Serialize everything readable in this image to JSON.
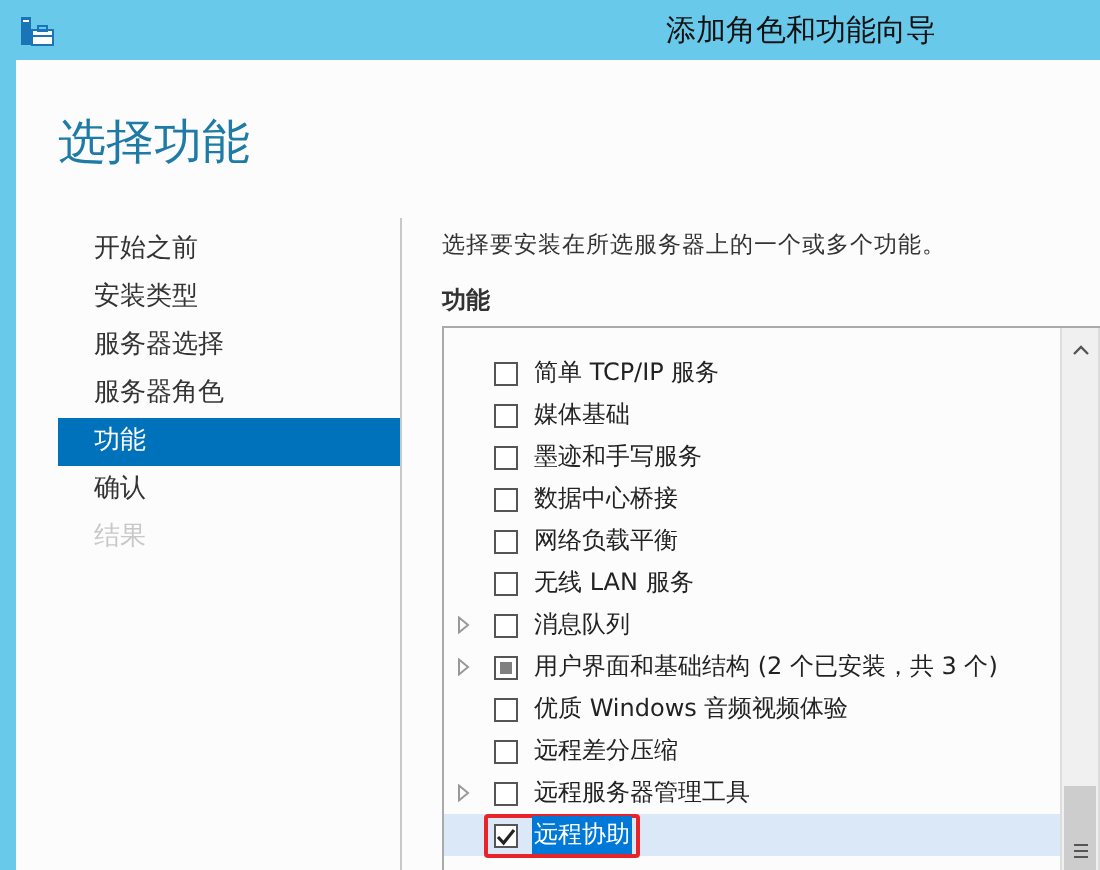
{
  "window": {
    "title": "添加角色和功能向导"
  },
  "page_title": "选择功能",
  "nav": [
    {
      "label": "开始之前",
      "selected": false,
      "disabled": false
    },
    {
      "label": "安装类型",
      "selected": false,
      "disabled": false
    },
    {
      "label": "服务器选择",
      "selected": false,
      "disabled": false
    },
    {
      "label": "服务器角色",
      "selected": false,
      "disabled": false
    },
    {
      "label": "功能",
      "selected": true,
      "disabled": false
    },
    {
      "label": "确认",
      "selected": false,
      "disabled": false
    },
    {
      "label": "结果",
      "selected": false,
      "disabled": true
    }
  ],
  "description": "选择要安装在所选服务器上的一个或多个功能。",
  "features_label": "功能",
  "features": [
    {
      "label": "简单 TCP/IP 服务",
      "checked": false,
      "indeterminate": false,
      "expandable": false,
      "selected": false,
      "marked": false
    },
    {
      "label": "媒体基础",
      "checked": false,
      "indeterminate": false,
      "expandable": false,
      "selected": false,
      "marked": false
    },
    {
      "label": "墨迹和手写服务",
      "checked": false,
      "indeterminate": false,
      "expandable": false,
      "selected": false,
      "marked": false
    },
    {
      "label": "数据中心桥接",
      "checked": false,
      "indeterminate": false,
      "expandable": false,
      "selected": false,
      "marked": false
    },
    {
      "label": "网络负载平衡",
      "checked": false,
      "indeterminate": false,
      "expandable": false,
      "selected": false,
      "marked": false
    },
    {
      "label": "无线 LAN 服务",
      "checked": false,
      "indeterminate": false,
      "expandable": false,
      "selected": false,
      "marked": false
    },
    {
      "label": "消息队列",
      "checked": false,
      "indeterminate": false,
      "expandable": true,
      "selected": false,
      "marked": false
    },
    {
      "label": "用户界面和基础结构 (2 个已安装，共 3 个)",
      "checked": false,
      "indeterminate": true,
      "expandable": true,
      "selected": false,
      "marked": false
    },
    {
      "label": "优质 Windows 音频视频体验",
      "checked": false,
      "indeterminate": false,
      "expandable": false,
      "selected": false,
      "marked": false
    },
    {
      "label": "远程差分压缩",
      "checked": false,
      "indeterminate": false,
      "expandable": false,
      "selected": false,
      "marked": false
    },
    {
      "label": "远程服务器管理工具",
      "checked": false,
      "indeterminate": false,
      "expandable": true,
      "selected": false,
      "marked": false
    },
    {
      "label": "远程协助",
      "checked": true,
      "indeterminate": false,
      "expandable": false,
      "selected": true,
      "marked": true
    }
  ]
}
